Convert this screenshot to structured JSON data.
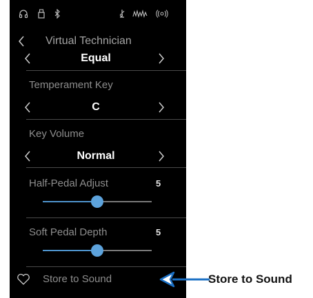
{
  "header": {
    "back_icon": "chevron-left-icon",
    "title": "Virtual Technician"
  },
  "status_icons": [
    "headphones-icon",
    "usb-icon",
    "bluetooth-icon",
    "metronome-icon",
    "recorder-icon",
    "speaker-icon"
  ],
  "temperament": {
    "value": "Equal"
  },
  "temperament_key": {
    "label": "Temperament Key",
    "value": "C"
  },
  "key_volume": {
    "label": "Key Volume",
    "value": "Normal"
  },
  "half_pedal": {
    "label": "Half-Pedal Adjust",
    "value": "5",
    "level": 0.5
  },
  "soft_pedal": {
    "label": "Soft Pedal Depth",
    "value": "5",
    "level": 0.5
  },
  "store": {
    "icon": "heart-icon",
    "label": "Store to Sound"
  },
  "callout": {
    "label": "Store to Sound"
  },
  "colors": {
    "accent": "#5da3dc",
    "callout": "#1a6fc4",
    "background": "#000000"
  }
}
